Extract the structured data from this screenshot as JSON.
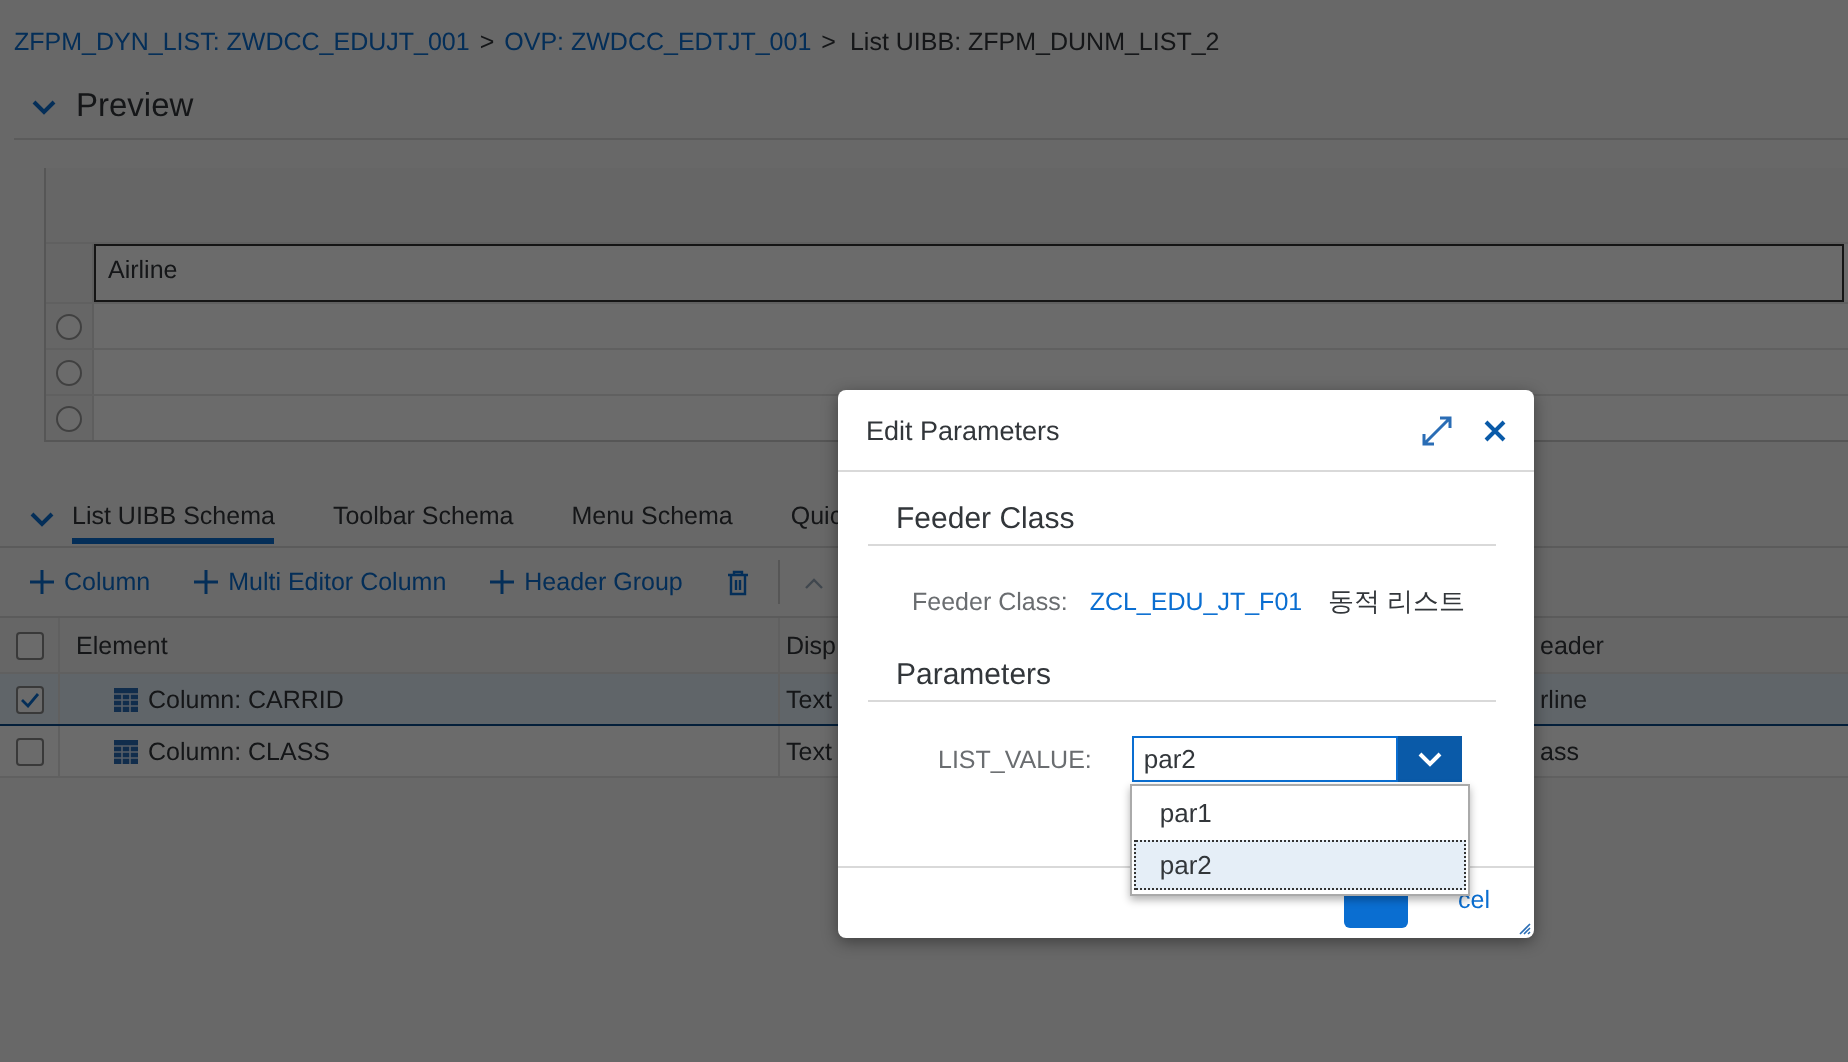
{
  "breadcrumb": [
    {
      "kind": "link",
      "label": "ZFPM_DYN_LIST: ZWDCC_EDUJT_001"
    },
    {
      "kind": "separator",
      "label": ">"
    },
    {
      "kind": "link",
      "label": "OVP: ZWDCC_EDTJT_001"
    },
    {
      "kind": "separator",
      "label": ">"
    },
    {
      "kind": "current",
      "label": "List UIBB: ZFPM_DUNM_LIST_2"
    }
  ],
  "preview": {
    "title": "Preview",
    "expanded": true,
    "table": {
      "columns": [
        "Airline"
      ],
      "rows": [
        {
          "selected": false
        },
        {
          "selected": false
        },
        {
          "selected": false
        }
      ]
    }
  },
  "schema_tabs": [
    {
      "label": "List UIBB Schema",
      "selected": true
    },
    {
      "label": "Toolbar Schema",
      "selected": false
    },
    {
      "label": "Menu Schema",
      "selected": false
    },
    {
      "label": "Quic",
      "selected": false
    }
  ],
  "schema_expanded": true,
  "toolbar": [
    {
      "kind": "add",
      "label": "Column"
    },
    {
      "kind": "add",
      "label": "Multi Editor Column"
    },
    {
      "kind": "add",
      "label": "Header Group"
    },
    {
      "kind": "delete"
    },
    {
      "kind": "move-up",
      "disabled": true
    }
  ],
  "schema_table": {
    "all_checked": false,
    "columns": [
      "Element",
      "Disp",
      "eader"
    ],
    "rows": [
      {
        "element": "Column: CARRID",
        "column_2": "Text",
        "column_3": "rline",
        "checked": true,
        "selected": true
      },
      {
        "element": "Column: CLASS",
        "column_2": "Text",
        "column_3": "ass",
        "checked": false,
        "selected": false
      }
    ]
  },
  "dialog": {
    "title": "Edit Parameters",
    "feeder_section": {
      "title": "Feeder Class",
      "label": "Feeder Class:",
      "class_link": "ZCL_EDU_JT_F01",
      "description": "동적 리스트"
    },
    "parameters_section": {
      "title": "Parameters",
      "fields": [
        {
          "label": "LIST_VALUE:",
          "value": "par2",
          "open": true,
          "options": [
            {
              "label": "par1",
              "selected": false
            },
            {
              "label": "par2",
              "selected": true
            }
          ]
        }
      ]
    },
    "footer": [
      {
        "kind": "primary"
      },
      {
        "kind": "cancel",
        "label": "cel"
      }
    ]
  }
}
